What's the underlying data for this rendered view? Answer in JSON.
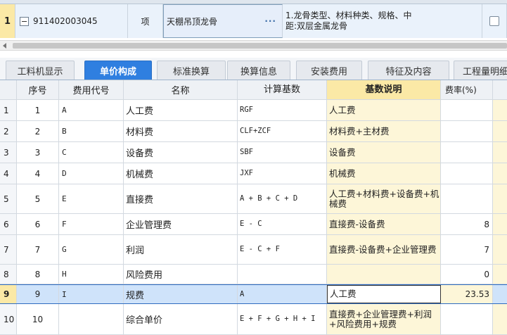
{
  "top_row": {
    "row_number": "1",
    "code": "911402003045",
    "unit": "项",
    "name": "天棚吊顶龙骨",
    "dots": "···",
    "description": "1.龙骨类型、材料种类、规格、中\n距:双层金属龙骨"
  },
  "tabs": [
    {
      "label": "工料机显示",
      "active": false
    },
    {
      "label": "单价构成",
      "active": true
    },
    {
      "label": "标准换算",
      "active": false
    },
    {
      "label": "换算信息",
      "active": false
    },
    {
      "label": "安装费用",
      "active": false
    },
    {
      "label": "特征及内容",
      "active": false
    },
    {
      "label": "工程量明细",
      "active": false
    }
  ],
  "grid": {
    "headers": {
      "seq": "序号",
      "code": "费用代号",
      "name": "名称",
      "base": "计算基数",
      "desc": "基数说明",
      "rate": "费率(%)"
    },
    "rows": [
      {
        "rn": "1",
        "seq": "1",
        "code": "A",
        "name": "人工费",
        "base": "RGF",
        "desc": "人工费",
        "rate": ""
      },
      {
        "rn": "2",
        "seq": "2",
        "code": "B",
        "name": "材料费",
        "base": "CLF+ZCF",
        "desc": "材料费+主材费",
        "rate": ""
      },
      {
        "rn": "3",
        "seq": "3",
        "code": "C",
        "name": "设备费",
        "base": "SBF",
        "desc": "设备费",
        "rate": ""
      },
      {
        "rn": "4",
        "seq": "4",
        "code": "D",
        "name": "机械费",
        "base": "JXF",
        "desc": "机械费",
        "rate": ""
      },
      {
        "rn": "5",
        "seq": "5",
        "code": "E",
        "name": "直接费",
        "base": "A + B + C + D",
        "desc": "人工费+材料费+设备费+机械费",
        "rate": ""
      },
      {
        "rn": "6",
        "seq": "6",
        "code": "F",
        "name": "企业管理费",
        "base": "E - C",
        "desc": "直接费-设备费",
        "rate": "8"
      },
      {
        "rn": "7",
        "seq": "7",
        "code": "G",
        "name": "利润",
        "base": "E - C + F",
        "desc": "直接费-设备费+企业管理费",
        "rate": "7"
      },
      {
        "rn": "8",
        "seq": "8",
        "code": "H",
        "name": "风险费用",
        "base": "",
        "desc": "",
        "rate": "0"
      },
      {
        "rn": "9",
        "seq": "9",
        "code": "I",
        "name": "规费",
        "base": "A",
        "desc": "人工费",
        "rate": "23.53"
      },
      {
        "rn": "10",
        "seq": "10",
        "code": "",
        "name": "综合单价",
        "base": "E + F + G + H + I",
        "desc": "直接费+企业管理费+利润+风险费用+规费",
        "rate": ""
      }
    ]
  },
  "colors": {
    "active_tab": "#2f7fe0",
    "highlight_header": "#fbe9a6",
    "selected_row": "#cfe3fa"
  }
}
